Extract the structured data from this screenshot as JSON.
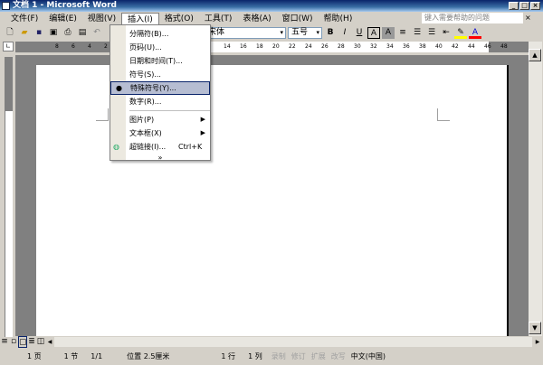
{
  "window": {
    "title": "文档 1 - Microsoft Word"
  },
  "menubar": [
    "文件(F)",
    "编辑(E)",
    "视图(V)",
    "插入(I)",
    "格式(O)",
    "工具(T)",
    "表格(A)",
    "窗口(W)",
    "帮助(H)"
  ],
  "help_placeholder": "键入需要帮助的问题",
  "toolbar": {
    "font": "宋体",
    "size": "五号",
    "bold": "B",
    "italic": "I",
    "underline": "U",
    "char_border": "A",
    "char_shade": "A",
    "font_color": "A",
    "highlight_color": "#ffff00",
    "font_color_value": "#ff0000"
  },
  "ruler": {
    "left_ticks": [
      "8",
      "6",
      "4",
      "2"
    ],
    "right_ticks": [
      "14",
      "16",
      "18",
      "20",
      "22",
      "24",
      "26",
      "28",
      "30",
      "32",
      "34",
      "36",
      "38",
      "40",
      "42",
      "44",
      "46",
      "48"
    ]
  },
  "insert_menu": {
    "items": [
      {
        "label": "分隔符(B)..."
      },
      {
        "label": "页码(U)..."
      },
      {
        "label": "日期和时间(T)..."
      },
      {
        "label": "符号(S)..."
      },
      {
        "label": "特殊符号(Y)...",
        "highlighted": true
      },
      {
        "label": "数字(R)..."
      },
      {
        "label": "图片(P)",
        "submenu": true
      },
      {
        "label": "文本框(X)",
        "submenu": true
      },
      {
        "label": "超链接(I)...",
        "shortcut": "Ctrl+K"
      }
    ],
    "expand": "»"
  },
  "status": {
    "page": "1 页",
    "section": "1 节",
    "pages": "1/1",
    "position": "位置 2.5厘米",
    "line": "1 行",
    "col": "1 列",
    "rec": "录制",
    "trk": "修订",
    "ext": "扩展",
    "ovr": "改写",
    "lang": "中文(中国)"
  }
}
